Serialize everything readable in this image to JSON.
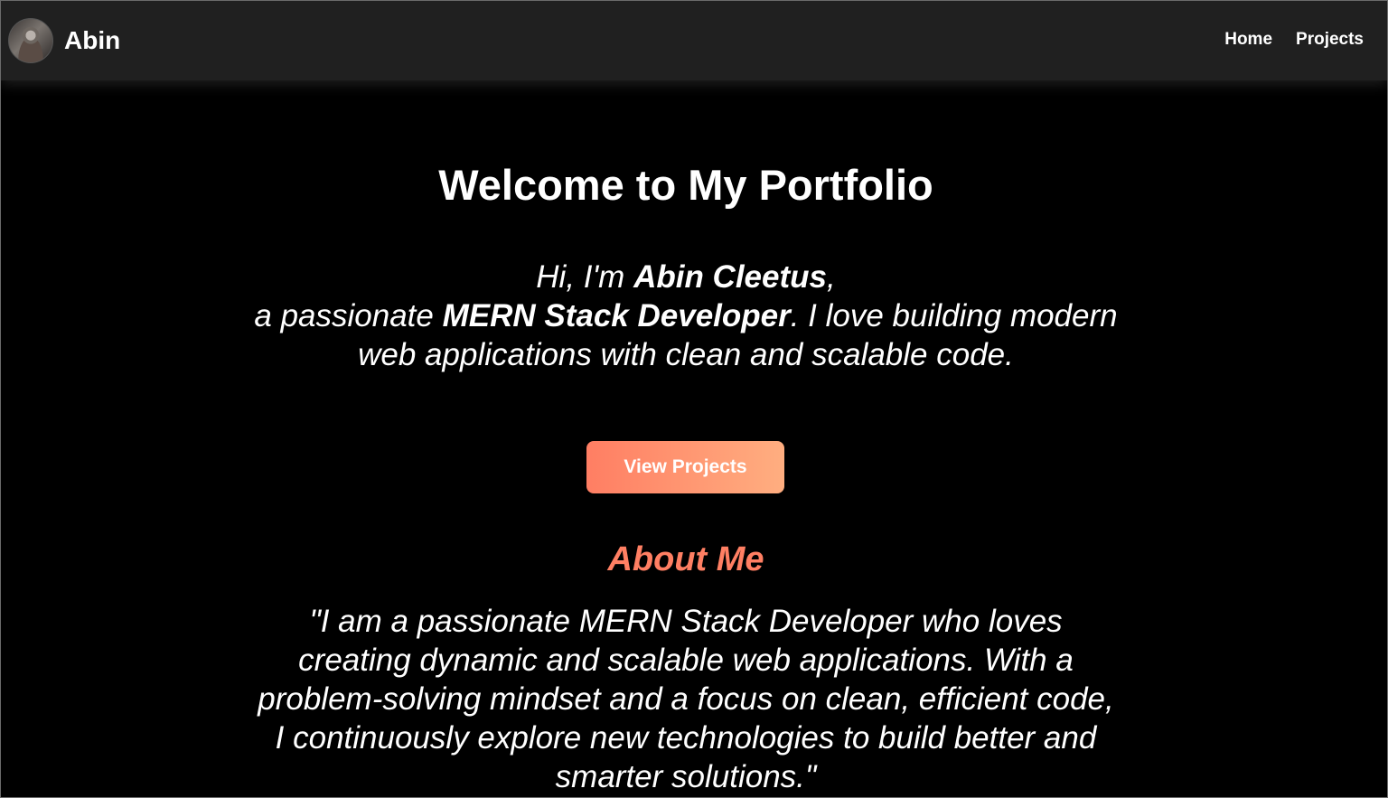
{
  "navbar": {
    "brand": "Abin",
    "links": [
      "Home",
      "Projects"
    ]
  },
  "hero": {
    "title": "Welcome to My Portfolio",
    "intro": {
      "greeting_prefix": "Hi, I'm ",
      "name": "Abin Cleetus",
      "greeting_suffix": ",",
      "role_prefix": "a passionate ",
      "role": "MERN Stack Developer",
      "role_suffix": ". I love building modern web applications with clean and scalable code."
    },
    "cta_label": "View Projects"
  },
  "about": {
    "title": "About Me",
    "text": "\"I am a passionate MERN Stack Developer who loves creating dynamic and scalable web applications. With a problem-solving mindset and a focus on clean, efficient code, I continuously explore new technologies to build better and smarter solutions.\""
  },
  "colors": {
    "background": "#000000",
    "navbar": "#202020",
    "accent": "#ff7f63",
    "button_gradient": [
      "#ff7e63",
      "#ffae80"
    ]
  },
  "icons": {
    "avatar": "profile-photo"
  }
}
